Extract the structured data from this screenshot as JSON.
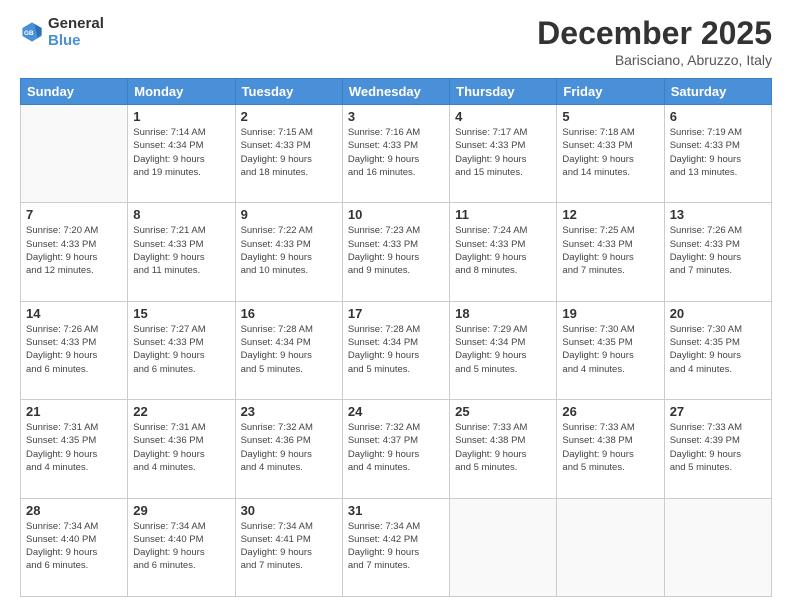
{
  "logo": {
    "line1": "General",
    "line2": "Blue"
  },
  "title": "December 2025",
  "subtitle": "Barisciano, Abruzzo, Italy",
  "headers": [
    "Sunday",
    "Monday",
    "Tuesday",
    "Wednesday",
    "Thursday",
    "Friday",
    "Saturday"
  ],
  "weeks": [
    [
      {
        "day": "",
        "text": ""
      },
      {
        "day": "1",
        "text": "Sunrise: 7:14 AM\nSunset: 4:34 PM\nDaylight: 9 hours\nand 19 minutes."
      },
      {
        "day": "2",
        "text": "Sunrise: 7:15 AM\nSunset: 4:33 PM\nDaylight: 9 hours\nand 18 minutes."
      },
      {
        "day": "3",
        "text": "Sunrise: 7:16 AM\nSunset: 4:33 PM\nDaylight: 9 hours\nand 16 minutes."
      },
      {
        "day": "4",
        "text": "Sunrise: 7:17 AM\nSunset: 4:33 PM\nDaylight: 9 hours\nand 15 minutes."
      },
      {
        "day": "5",
        "text": "Sunrise: 7:18 AM\nSunset: 4:33 PM\nDaylight: 9 hours\nand 14 minutes."
      },
      {
        "day": "6",
        "text": "Sunrise: 7:19 AM\nSunset: 4:33 PM\nDaylight: 9 hours\nand 13 minutes."
      }
    ],
    [
      {
        "day": "7",
        "text": "Sunrise: 7:20 AM\nSunset: 4:33 PM\nDaylight: 9 hours\nand 12 minutes."
      },
      {
        "day": "8",
        "text": "Sunrise: 7:21 AM\nSunset: 4:33 PM\nDaylight: 9 hours\nand 11 minutes."
      },
      {
        "day": "9",
        "text": "Sunrise: 7:22 AM\nSunset: 4:33 PM\nDaylight: 9 hours\nand 10 minutes."
      },
      {
        "day": "10",
        "text": "Sunrise: 7:23 AM\nSunset: 4:33 PM\nDaylight: 9 hours\nand 9 minutes."
      },
      {
        "day": "11",
        "text": "Sunrise: 7:24 AM\nSunset: 4:33 PM\nDaylight: 9 hours\nand 8 minutes."
      },
      {
        "day": "12",
        "text": "Sunrise: 7:25 AM\nSunset: 4:33 PM\nDaylight: 9 hours\nand 7 minutes."
      },
      {
        "day": "13",
        "text": "Sunrise: 7:26 AM\nSunset: 4:33 PM\nDaylight: 9 hours\nand 7 minutes."
      }
    ],
    [
      {
        "day": "14",
        "text": "Sunrise: 7:26 AM\nSunset: 4:33 PM\nDaylight: 9 hours\nand 6 minutes."
      },
      {
        "day": "15",
        "text": "Sunrise: 7:27 AM\nSunset: 4:33 PM\nDaylight: 9 hours\nand 6 minutes."
      },
      {
        "day": "16",
        "text": "Sunrise: 7:28 AM\nSunset: 4:34 PM\nDaylight: 9 hours\nand 5 minutes."
      },
      {
        "day": "17",
        "text": "Sunrise: 7:28 AM\nSunset: 4:34 PM\nDaylight: 9 hours\nand 5 minutes."
      },
      {
        "day": "18",
        "text": "Sunrise: 7:29 AM\nSunset: 4:34 PM\nDaylight: 9 hours\nand 5 minutes."
      },
      {
        "day": "19",
        "text": "Sunrise: 7:30 AM\nSunset: 4:35 PM\nDaylight: 9 hours\nand 4 minutes."
      },
      {
        "day": "20",
        "text": "Sunrise: 7:30 AM\nSunset: 4:35 PM\nDaylight: 9 hours\nand 4 minutes."
      }
    ],
    [
      {
        "day": "21",
        "text": "Sunrise: 7:31 AM\nSunset: 4:35 PM\nDaylight: 9 hours\nand 4 minutes."
      },
      {
        "day": "22",
        "text": "Sunrise: 7:31 AM\nSunset: 4:36 PM\nDaylight: 9 hours\nand 4 minutes."
      },
      {
        "day": "23",
        "text": "Sunrise: 7:32 AM\nSunset: 4:36 PM\nDaylight: 9 hours\nand 4 minutes."
      },
      {
        "day": "24",
        "text": "Sunrise: 7:32 AM\nSunset: 4:37 PM\nDaylight: 9 hours\nand 4 minutes."
      },
      {
        "day": "25",
        "text": "Sunrise: 7:33 AM\nSunset: 4:38 PM\nDaylight: 9 hours\nand 5 minutes."
      },
      {
        "day": "26",
        "text": "Sunrise: 7:33 AM\nSunset: 4:38 PM\nDaylight: 9 hours\nand 5 minutes."
      },
      {
        "day": "27",
        "text": "Sunrise: 7:33 AM\nSunset: 4:39 PM\nDaylight: 9 hours\nand 5 minutes."
      }
    ],
    [
      {
        "day": "28",
        "text": "Sunrise: 7:34 AM\nSunset: 4:40 PM\nDaylight: 9 hours\nand 6 minutes."
      },
      {
        "day": "29",
        "text": "Sunrise: 7:34 AM\nSunset: 4:40 PM\nDaylight: 9 hours\nand 6 minutes."
      },
      {
        "day": "30",
        "text": "Sunrise: 7:34 AM\nSunset: 4:41 PM\nDaylight: 9 hours\nand 7 minutes."
      },
      {
        "day": "31",
        "text": "Sunrise: 7:34 AM\nSunset: 4:42 PM\nDaylight: 9 hours\nand 7 minutes."
      },
      {
        "day": "",
        "text": ""
      },
      {
        "day": "",
        "text": ""
      },
      {
        "day": "",
        "text": ""
      }
    ]
  ]
}
